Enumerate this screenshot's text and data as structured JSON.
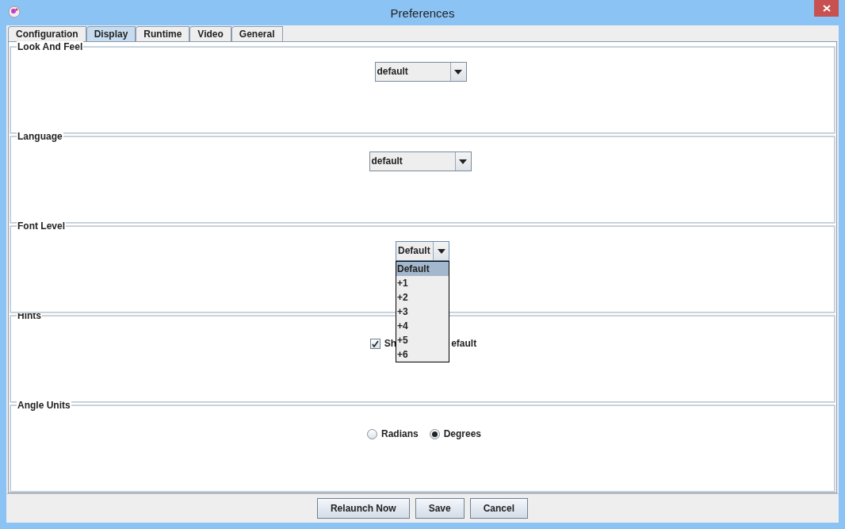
{
  "window": {
    "title": "Preferences"
  },
  "tabs": [
    {
      "label": "Configuration",
      "selected": false
    },
    {
      "label": "Display",
      "selected": true
    },
    {
      "label": "Runtime",
      "selected": false
    },
    {
      "label": "Video",
      "selected": false
    },
    {
      "label": "General",
      "selected": false
    }
  ],
  "sections": [
    {
      "kind": "combo",
      "title": "Look And Feel",
      "value": "default",
      "open": false
    },
    {
      "kind": "combo",
      "title": "Language",
      "value": "default",
      "open": false
    },
    {
      "kind": "combo",
      "title": "Font Level",
      "value": "Default",
      "open": true,
      "options": [
        {
          "label": "Default",
          "selected": true
        },
        {
          "label": "+1",
          "selected": false
        },
        {
          "label": "+2",
          "selected": false
        },
        {
          "label": "+3",
          "selected": false
        },
        {
          "label": "+4",
          "selected": false
        },
        {
          "label": "+5",
          "selected": false
        },
        {
          "label": "+6",
          "selected": false
        }
      ]
    },
    {
      "kind": "checkbox",
      "title": "Hints",
      "label_start": "Sh",
      "label_end": "efault",
      "checked": true
    },
    {
      "kind": "radio",
      "title": "Angle Units",
      "options": [
        {
          "label": "Radians",
          "selected": false
        },
        {
          "label": "Degrees",
          "selected": true
        }
      ]
    }
  ],
  "buttons": [
    "Relaunch Now",
    "Save",
    "Cancel"
  ]
}
